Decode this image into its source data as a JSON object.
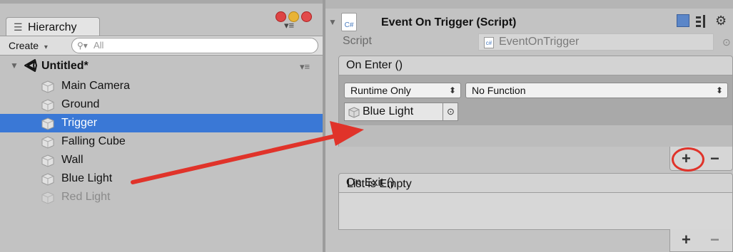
{
  "hierarchy": {
    "tab_label": "Hierarchy",
    "create_label": "Create",
    "search_placeholder": "All",
    "scene_name": "Untitled*",
    "items": [
      {
        "label": "Main Camera",
        "state": "normal"
      },
      {
        "label": "Ground",
        "state": "normal"
      },
      {
        "label": "Trigger",
        "state": "selected"
      },
      {
        "label": "Falling Cube",
        "state": "normal"
      },
      {
        "label": "Wall",
        "state": "normal"
      },
      {
        "label": "Blue Light",
        "state": "normal"
      },
      {
        "label": "Red Light",
        "state": "disabled"
      }
    ]
  },
  "inspector": {
    "component_title": "Event On Trigger (Script)",
    "script_icon_text": "C#",
    "script_label": "Script",
    "script_value": "EventOnTrigger",
    "on_enter": {
      "header": "On Enter ()",
      "runtime_option": "Runtime Only",
      "function_option": "No Function",
      "object_value": "Blue Light"
    },
    "on_exit": {
      "header": "On Exit ()",
      "empty_text": "List is Empty"
    },
    "add_label": "+",
    "remove_label": "−"
  },
  "colors": {
    "selection": "#3a78d6",
    "annotation_red": "#e0332a"
  },
  "icons": [
    "hierarchy-menu-icon",
    "window-close-icon",
    "create-dropdown-icon",
    "search-icon",
    "unity-logo-icon",
    "cube-icon",
    "script-icon",
    "help-icon",
    "preset-icon",
    "gear-icon",
    "object-target-icon"
  ]
}
